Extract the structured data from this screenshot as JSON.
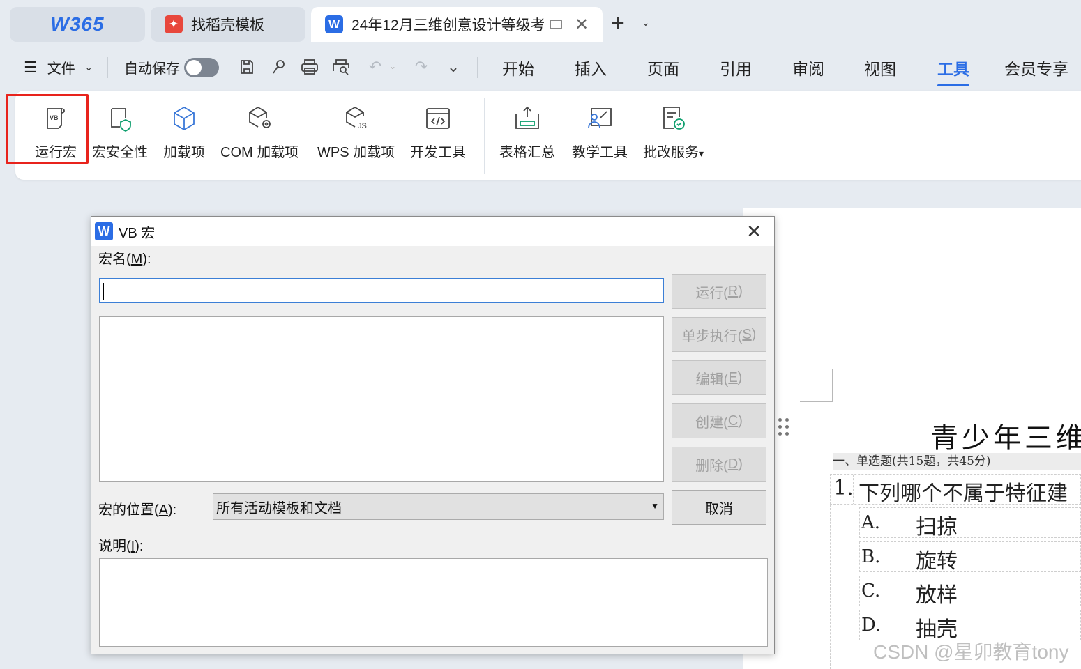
{
  "tabs": {
    "home_logo": "W365",
    "template_tab": "找稻壳模板",
    "doc_tab": "24年12月三维创意设计等级考",
    "doc_icon_letter": "W"
  },
  "menubar": {
    "file": "文件",
    "autosave": "自动保存",
    "items": [
      "开始",
      "插入",
      "页面",
      "引用",
      "审阅",
      "视图",
      "工具",
      "会员专享"
    ],
    "active": "工具"
  },
  "ribbon": {
    "buttons": [
      "运行宏",
      "宏安全性",
      "加载项",
      "COM 加载项",
      "WPS 加载项",
      "开发工具",
      "表格汇总",
      "教学工具",
      "批改服务"
    ],
    "dropdown_suffix": "▾"
  },
  "dialog": {
    "title": "VB 宏",
    "icon_letter": "W",
    "macro_name_label": "宏名(",
    "macro_name_key": "M",
    "macro_name_end": "):",
    "macro_name_value": "",
    "location_label": "宏的位置(",
    "location_key": "A",
    "location_end": "):",
    "location_value": "所有活动模板和文档",
    "description_label": "说明(",
    "description_key": "I",
    "description_end": "):",
    "buttons": {
      "run": {
        "text": "运行(",
        "key": "R"
      },
      "step": {
        "text": "单步执行(",
        "key": "S"
      },
      "edit": {
        "text": "编辑(",
        "key": "E"
      },
      "create": {
        "text": "创建(",
        "key": "C"
      },
      "delete": {
        "text": "删除(",
        "key": "D"
      },
      "cancel": "取消"
    }
  },
  "document": {
    "title": "青少年三维",
    "section": "一、单选题(共15题，共45分)",
    "question_number": "1.",
    "question_text": "下列哪个不属于特征建",
    "options": [
      {
        "letter": "A.",
        "text": "扫掠"
      },
      {
        "letter": "B.",
        "text": "旋转"
      },
      {
        "letter": "C.",
        "text": "放样"
      },
      {
        "letter": "D.",
        "text": "抽壳"
      }
    ]
  },
  "watermark": "CSDN @星卯教育tony",
  "colors": {
    "accent": "#2b6de5",
    "highlight": "#e8231c",
    "background": "#e6ebf1"
  }
}
